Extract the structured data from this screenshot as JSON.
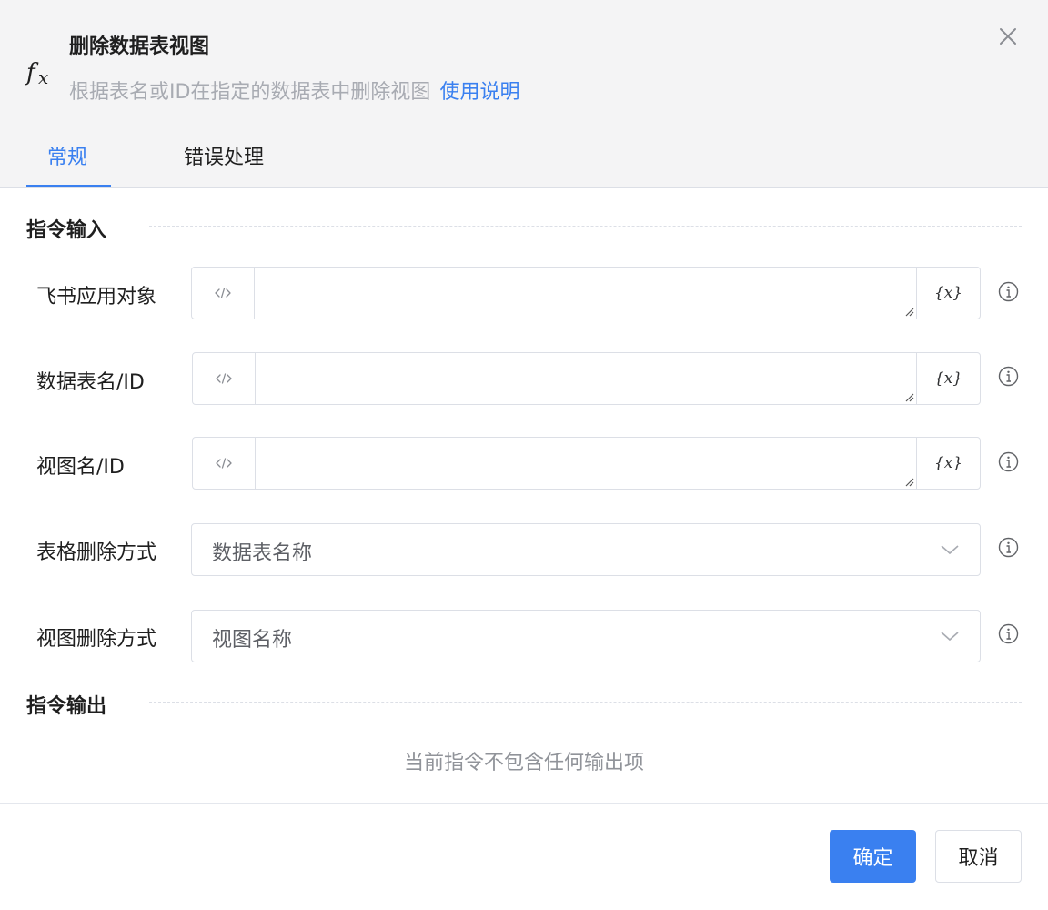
{
  "header": {
    "title": "删除数据表视图",
    "subtitle": "根据表名或ID在指定的数据表中删除视图",
    "help_link": "使用说明"
  },
  "tabs": [
    {
      "label": "常规",
      "active": true
    },
    {
      "label": "错误处理",
      "active": false
    }
  ],
  "input_section": {
    "title": "指令输入",
    "fields": [
      {
        "label": "飞书应用对象",
        "type": "expression-input",
        "value": "",
        "var_button": "{x}"
      },
      {
        "label": "数据表名/ID",
        "type": "expression-input",
        "value": "",
        "var_button": "{x}"
      },
      {
        "label": "视图名/ID",
        "type": "expression-input",
        "value": "",
        "var_button": "{x}"
      },
      {
        "label": "表格删除方式",
        "type": "select",
        "value": "数据表名称"
      },
      {
        "label": "视图删除方式",
        "type": "select",
        "value": "视图名称"
      }
    ]
  },
  "output_section": {
    "title": "指令输出",
    "empty_text": "当前指令不包含任何输出项"
  },
  "footer": {
    "ok_label": "确定",
    "cancel_label": "取消"
  },
  "colors": {
    "accent": "#3a80f0",
    "header_bg": "#f4f4f5",
    "border": "#dcdfe6",
    "muted_text": "#a8abb2"
  },
  "icons": [
    "fx-icon",
    "close-icon",
    "code-icon",
    "variable-icon",
    "resize-grip-icon",
    "chevron-down-icon",
    "info-icon"
  ]
}
